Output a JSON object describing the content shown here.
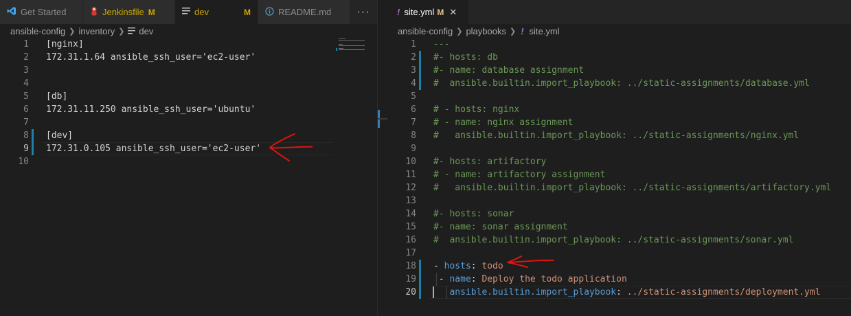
{
  "left": {
    "tabs": [
      {
        "label": "Get Started",
        "icon": "vscode-icon",
        "modified": "",
        "active": false
      },
      {
        "label": "Jenkinsfile",
        "icon": "jenkins-icon",
        "modified": "M",
        "active": false
      },
      {
        "label": "dev",
        "icon": "lines-icon",
        "modified": "M",
        "active": true
      },
      {
        "label": "README.md",
        "icon": "info-icon",
        "modified": "",
        "active": false
      }
    ],
    "more_label": "···",
    "breadcrumb": [
      "ansible-config",
      "inventory",
      "dev"
    ],
    "lines": [
      {
        "n": "1",
        "text": "[nginx]"
      },
      {
        "n": "2",
        "text": "172.31.1.64 ansible_ssh_user='ec2-user'"
      },
      {
        "n": "3",
        "text": ""
      },
      {
        "n": "4",
        "text": ""
      },
      {
        "n": "5",
        "text": "[db]"
      },
      {
        "n": "6",
        "text": "172.31.11.250 ansible_ssh_user='ubuntu'"
      },
      {
        "n": "7",
        "text": ""
      },
      {
        "n": "8",
        "text": "[dev]"
      },
      {
        "n": "9",
        "text": "172.31.0.105 ansible_ssh_user='ec2-user'"
      },
      {
        "n": "10",
        "text": ""
      }
    ]
  },
  "right": {
    "tab": {
      "label": "site.yml",
      "icon": "exclamation-icon",
      "modified": "M",
      "close": "✕"
    },
    "breadcrumb": [
      "ansible-config",
      "playbooks",
      "site.yml"
    ],
    "lines": [
      {
        "n": "1",
        "parts": [
          [
            "c",
            "---"
          ]
        ]
      },
      {
        "n": "2",
        "parts": [
          [
            "c",
            "#- hosts: db"
          ]
        ]
      },
      {
        "n": "3",
        "parts": [
          [
            "c",
            "#- name: database assignment"
          ]
        ]
      },
      {
        "n": "4",
        "parts": [
          [
            "c",
            "#  ansible.builtin.import_playbook: ../static-assignments/database.yml"
          ]
        ]
      },
      {
        "n": "5",
        "parts": []
      },
      {
        "n": "6",
        "parts": [
          [
            "c",
            "# - hosts: nginx"
          ]
        ]
      },
      {
        "n": "7",
        "parts": [
          [
            "c",
            "# - name: nginx assignment"
          ]
        ]
      },
      {
        "n": "8",
        "parts": [
          [
            "c",
            "#   ansible.builtin.import_playbook: ../static-assignments/nginx.yml"
          ]
        ]
      },
      {
        "n": "9",
        "parts": []
      },
      {
        "n": "10",
        "parts": [
          [
            "c",
            "#- hosts: artifactory"
          ]
        ]
      },
      {
        "n": "11",
        "parts": [
          [
            "c",
            "# - name: artifactory assignment"
          ]
        ]
      },
      {
        "n": "12",
        "parts": [
          [
            "c",
            "#   ansible.builtin.import_playbook: ../static-assignments/artifactory.yml"
          ]
        ]
      },
      {
        "n": "13",
        "parts": []
      },
      {
        "n": "14",
        "parts": [
          [
            "c",
            "#- hosts: sonar"
          ]
        ]
      },
      {
        "n": "15",
        "parts": [
          [
            "c",
            "#- name: sonar assignment"
          ]
        ]
      },
      {
        "n": "16",
        "parts": [
          [
            "c",
            "#  ansible.builtin.import_playbook: ../static-assignments/sonar.yml"
          ]
        ]
      },
      {
        "n": "17",
        "parts": []
      },
      {
        "n": "18",
        "parts": [
          [
            "p",
            "- "
          ],
          [
            "k",
            "hosts"
          ],
          [
            "p",
            ": "
          ],
          [
            "s",
            "todo"
          ]
        ]
      },
      {
        "n": "19",
        "parts": [
          [
            "p",
            " - "
          ],
          [
            "k",
            "name"
          ],
          [
            "p",
            ": "
          ],
          [
            "s",
            "Deploy the todo application"
          ]
        ]
      },
      {
        "n": "20",
        "parts": [
          [
            "p",
            "   "
          ],
          [
            "k",
            "ansible.builtin.import_playbook"
          ],
          [
            "p",
            ": "
          ],
          [
            "s",
            "../static-assignments/deployment.yml"
          ]
        ]
      }
    ]
  },
  "colors": {
    "background": "#1e1e1e",
    "comment": "#6a9955",
    "key": "#569cd6",
    "string": "#ce9178",
    "modified": "#e2c08d",
    "annotation_arrow": "#e0140f",
    "git_gutter": "#1b81a8"
  }
}
